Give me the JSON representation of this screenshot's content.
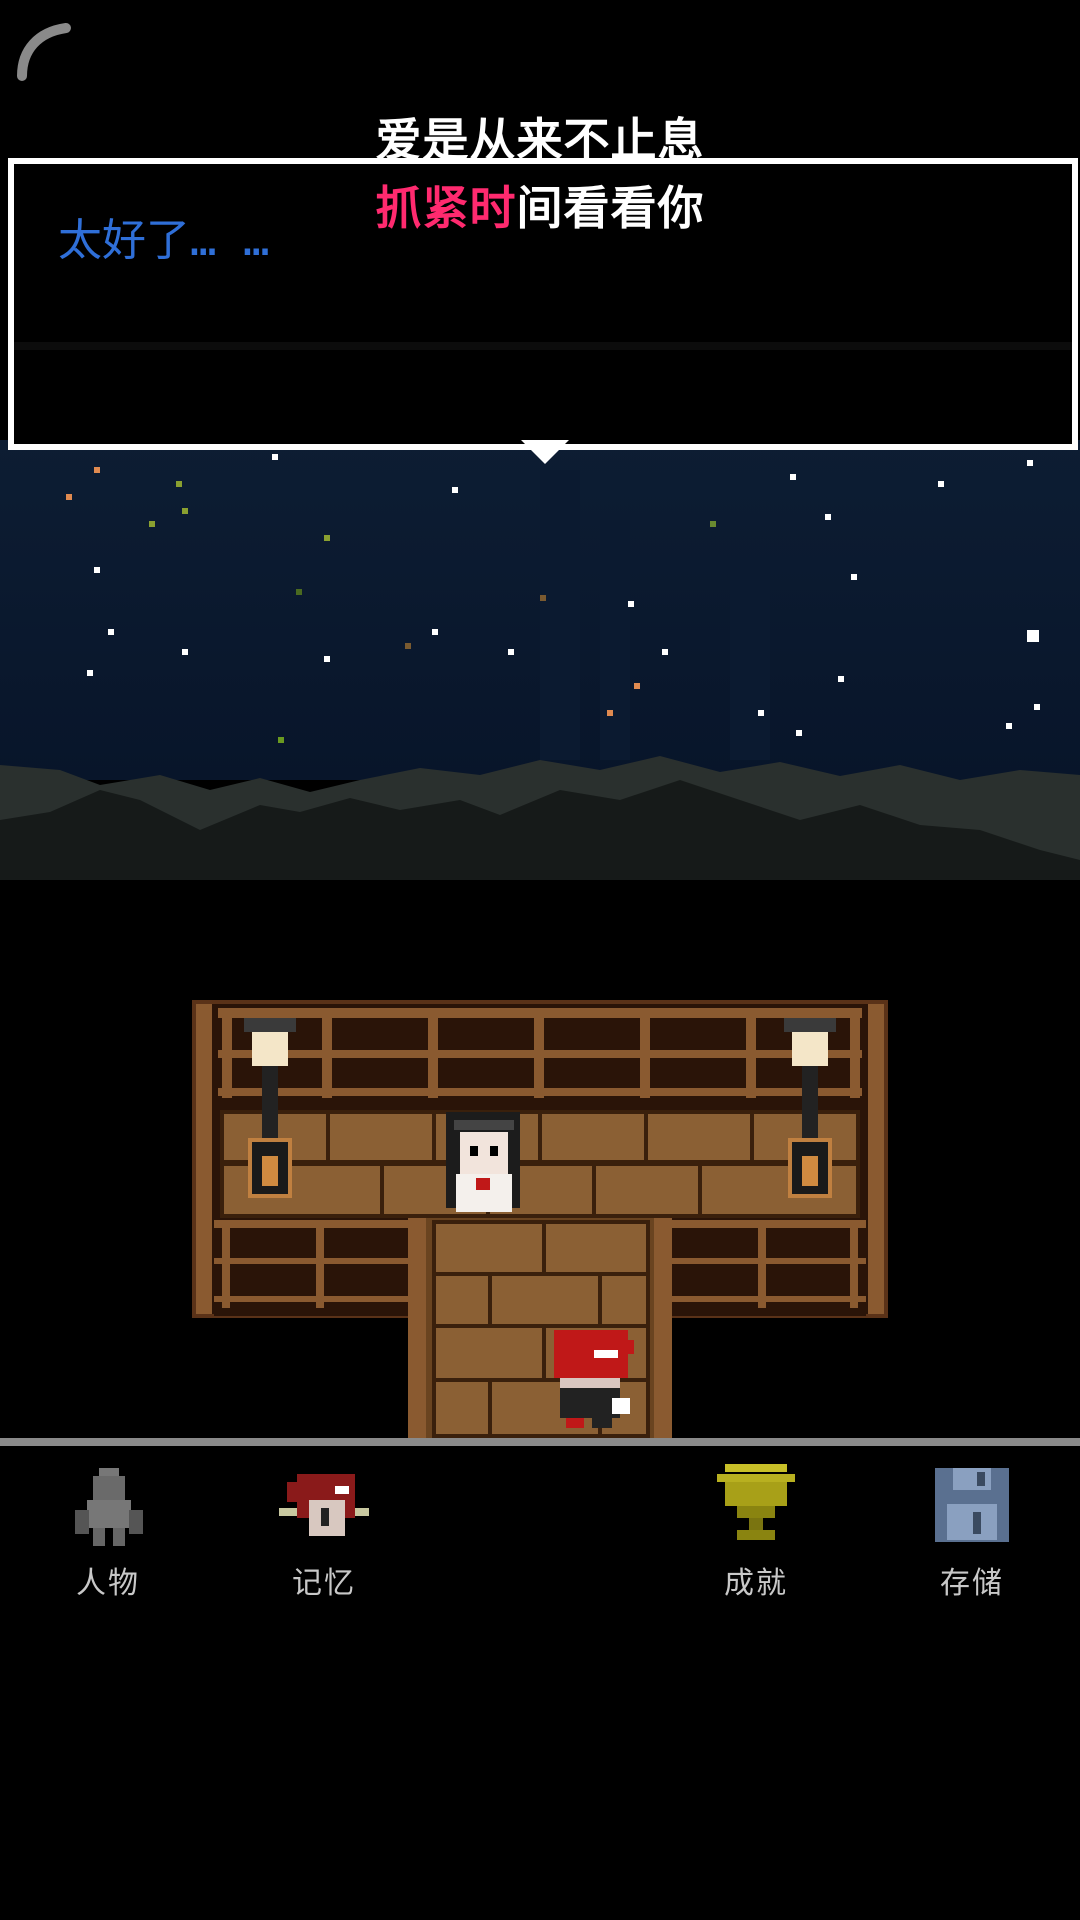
{
  "lyrics": {
    "line1": "爱是从来不止息",
    "line2_highlight": "抓紧时",
    "line2_rest": "间看看你"
  },
  "dialog": {
    "text": "太好了… …"
  },
  "menu": {
    "characters": "人物",
    "memories": "记忆",
    "achievements": "成就",
    "save": "存储"
  },
  "colors": {
    "dialog_text": "#2f6fd8",
    "lyric_highlight": "#ff2a6f",
    "sky": "#0a1a2e",
    "wood": "#8a5a30",
    "trophy": "#b8b020",
    "floppy": "#5a7090"
  }
}
